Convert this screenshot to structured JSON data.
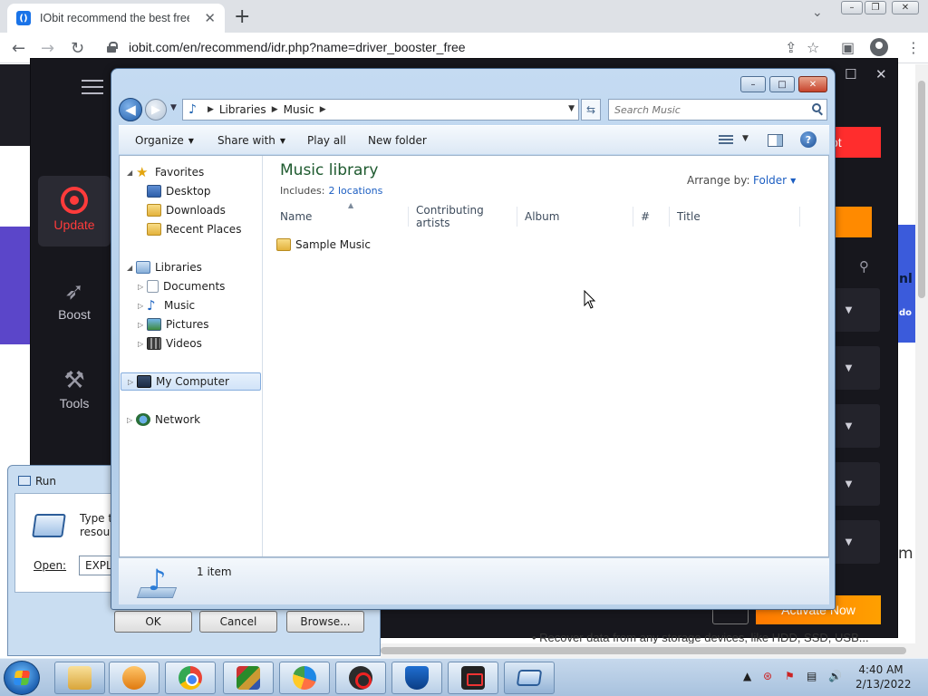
{
  "browser": {
    "tab_title": "IObit recommend the best free, f",
    "tab_favicon": "()",
    "url": "iobit.com/en/recommend/idr.php?name=driver_booster_free",
    "new_tab_symbol": "+",
    "tab_close_symbol": "✕",
    "back_symbol": "←",
    "forward_symbol": "→",
    "reload_symbol": "↻",
    "share_symbol": "⇪",
    "star_symbol": "☆",
    "sidepanel_symbol": "▣",
    "menu_symbol": "⋮",
    "tab_search_symbol": "⌄",
    "window_controls": {
      "minimize": "–",
      "maximize": "❐",
      "close": "✕"
    }
  },
  "background_app": {
    "sidebar": [
      {
        "label": "Update",
        "icon": "ring-icon"
      },
      {
        "label": "Boost",
        "icon": "rocket-icon",
        "glyph": "🚀"
      },
      {
        "label": "Tools",
        "icon": "tools-icon",
        "glyph": "✖"
      }
    ],
    "right_button_text": "ot",
    "activate_text": "Activate Now",
    "strip_text_1": "nl",
    "strip_text_2": "do",
    "edge_letter": "m",
    "window_ctl_max": "☐",
    "window_ctl_close": "✕",
    "recover_text": "•     Recover data from any storage devices, like HDD, SSD, USB..."
  },
  "run_dialog": {
    "title": "Run",
    "description_line1": "Type the",
    "description_line2": "resource",
    "open_label": "Open:",
    "open_value": "EXPLOR",
    "ok_label": "OK",
    "cancel_label": "Cancel",
    "browse_label": "Browse..."
  },
  "explorer": {
    "window_controls": {
      "minimize": "–",
      "maximize": "□",
      "close": "✕"
    },
    "back_symbol": "◀",
    "forward_symbol": "▶",
    "breadcrumb": [
      "Libraries",
      "Music"
    ],
    "refresh_symbol": "⇆",
    "search_placeholder": "Search Music",
    "toolbar": {
      "organize": "Organize",
      "share_with": "Share with",
      "play_all": "Play all",
      "new_folder": "New folder",
      "help": "?"
    },
    "nav": {
      "favorites": "Favorites",
      "desktop": "Desktop",
      "downloads": "Downloads",
      "recent_places": "Recent Places",
      "libraries": "Libraries",
      "documents": "Documents",
      "music": "Music",
      "pictures": "Pictures",
      "videos": "Videos",
      "my_computer": "My Computer",
      "network": "Network"
    },
    "library": {
      "title": "Music library",
      "includes_label": "Includes:",
      "locations_link": "2 locations",
      "arrange_label": "Arrange by:",
      "arrange_value": "Folder"
    },
    "columns": [
      "Name",
      "Contributing artists",
      "Album",
      "#",
      "Title"
    ],
    "files": [
      {
        "name": "Sample Music",
        "type": "folder"
      }
    ],
    "details": {
      "item_count": "1 item"
    }
  },
  "taskbar": {
    "apps": [
      "windows-explorer",
      "media-player",
      "chrome",
      "winrar",
      "orb-app",
      "driver-booster",
      "shield-app",
      "screen-recorder",
      "run"
    ],
    "tray": {
      "arrow": "▲",
      "volume": "🔊"
    },
    "clock_time": "4:40 AM",
    "clock_date": "2/13/2022"
  }
}
